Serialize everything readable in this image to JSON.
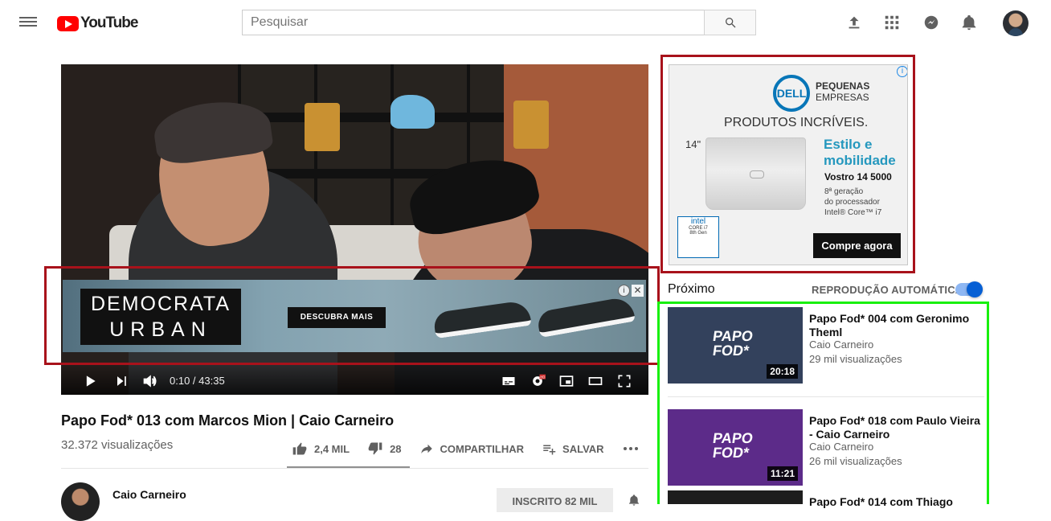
{
  "header": {
    "logo_label": "YouTube",
    "search_placeholder": "Pesquisar",
    "icons": [
      "menu-icon",
      "youtube-logo-icon",
      "search-icon",
      "upload-icon",
      "apps-icon",
      "messages-icon",
      "notifications-icon",
      "avatar"
    ]
  },
  "player": {
    "time": "0:10 / 43:35",
    "progress": 0.004,
    "ad": {
      "brand_line1": "DEMOCRATA",
      "brand_line2": "URBAN",
      "cta": "DESCUBRA MAIS",
      "info_icon": "i",
      "close_icon": "✕"
    },
    "badges": {
      "hd": "HD"
    }
  },
  "video": {
    "title": "Papo Fod* 013 com Marcos Mion | Caio Carneiro",
    "views": "32.372 visualizações",
    "likes": "2,4 MIL",
    "dislikes": "28",
    "share": "COMPARTILHAR",
    "save": "SALVAR",
    "channel_name": "Caio Carneiro",
    "subscribed": "INSCRITO  82 MIL"
  },
  "sidebar_ad": {
    "brand": "DELL",
    "program_line1": "PEQUENAS",
    "program_line2": "EMPRESAS",
    "headline": "PRODUTOS INCRÍVEIS.",
    "size": "14\"",
    "feature_line1": "Estilo e",
    "feature_line2": "mobilidade",
    "model": "Vostro 14 5000",
    "spec_line1": "8ª geração",
    "spec_line2": "do processador",
    "spec_line3": "Intel® Core™ i7",
    "intel_line1": "intel",
    "intel_line2": "CORE i7",
    "intel_line3": "8th Gen",
    "cta": "Compre agora",
    "choice": "i"
  },
  "next": {
    "label": "Próximo",
    "autoplay": "REPRODUÇÃO AUTOMÁTICA",
    "autoplay_on": true,
    "videos": [
      {
        "title": "Papo Fod* 004 com Geronimo Theml",
        "channel": "Caio Carneiro",
        "views": "29 mil visualizações",
        "duration": "20:18",
        "thumb_text_line1": "PAPO",
        "thumb_text_line2": "FOD*"
      },
      {
        "title": "Papo Fod* 018 com Paulo Vieira - Caio Carneiro",
        "channel": "Caio Carneiro",
        "views": "26 mil visualizações",
        "duration": "11:21",
        "thumb_text_line1": "PAPO",
        "thumb_text_line2": "FOD*"
      },
      {
        "title": "Papo Fod* 014 com Thiago"
      }
    ]
  },
  "colors": {
    "youtube_red": "#ff0000",
    "annotation_red": "#a8121b",
    "annotation_green": "#18f00d",
    "toggle_blue": "#065fd4",
    "dell_blue": "#0876b8"
  }
}
